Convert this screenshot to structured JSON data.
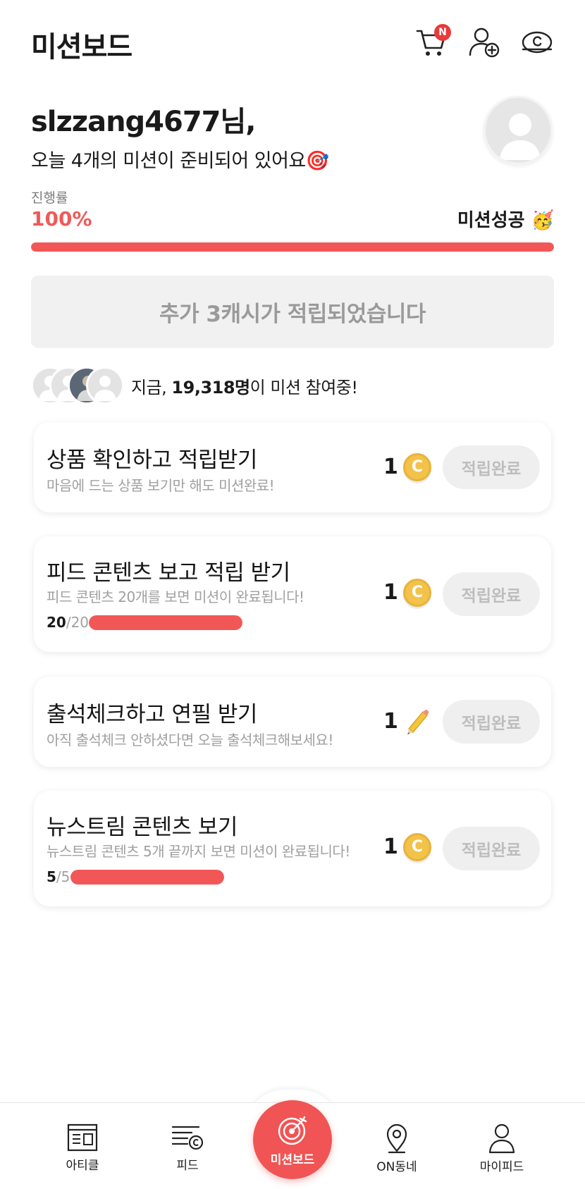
{
  "header": {
    "title": "미션보드",
    "cart_badge": "N",
    "icons": [
      "cart-icon",
      "add-friend-icon",
      "cash-icon"
    ]
  },
  "greeting": {
    "username": "slzzang4677님,",
    "message": "오늘 4개의 미션이 준비되어 있어요🎯"
  },
  "progress": {
    "label": "진행률",
    "value": "100%",
    "fraction": 1.0,
    "status": "미션성공 🥳"
  },
  "reward_notice": "추가 3캐시가 적립되었습니다",
  "participants": {
    "prefix": "지금, ",
    "count": "19,318명",
    "suffix": "이 미션 참여중!"
  },
  "missions": [
    {
      "title": "상품 확인하고 적립받기",
      "desc": "마음에 드는 상품 보기만 해도 미션완료!",
      "reward": "1",
      "reward_icon": "coin-icon",
      "button": "적립완료"
    },
    {
      "title": "피드 콘텐츠 보고 적립 받기",
      "desc": "피드 콘텐츠 20개를 보면 미션이 완료됩니다!",
      "count_done": "20",
      "count_total": "/20",
      "fraction": 1.0,
      "reward": "1",
      "reward_icon": "coin-icon",
      "button": "적립완료"
    },
    {
      "title": "출석체크하고 연필 받기",
      "desc": "아직 출석체크 안하셨다면 오늘 출석체크해보세요!",
      "reward": "1",
      "reward_icon": "pencil-icon",
      "button": "적립완료"
    },
    {
      "title": "뉴스트림 콘텐츠 보기",
      "desc": "뉴스트림 콘텐츠 5개 끝까지 보면 미션이 완료됩니다!",
      "count_done": "5",
      "count_total": "/5",
      "fraction": 1.0,
      "reward": "1",
      "reward_icon": "coin-icon",
      "button": "적립완료"
    }
  ],
  "nav": {
    "items": [
      "아티클",
      "피드",
      "미션보드",
      "ON동네",
      "마이피드"
    ]
  },
  "colors": {
    "accent": "#f25757",
    "coin": "#f2c24a"
  }
}
